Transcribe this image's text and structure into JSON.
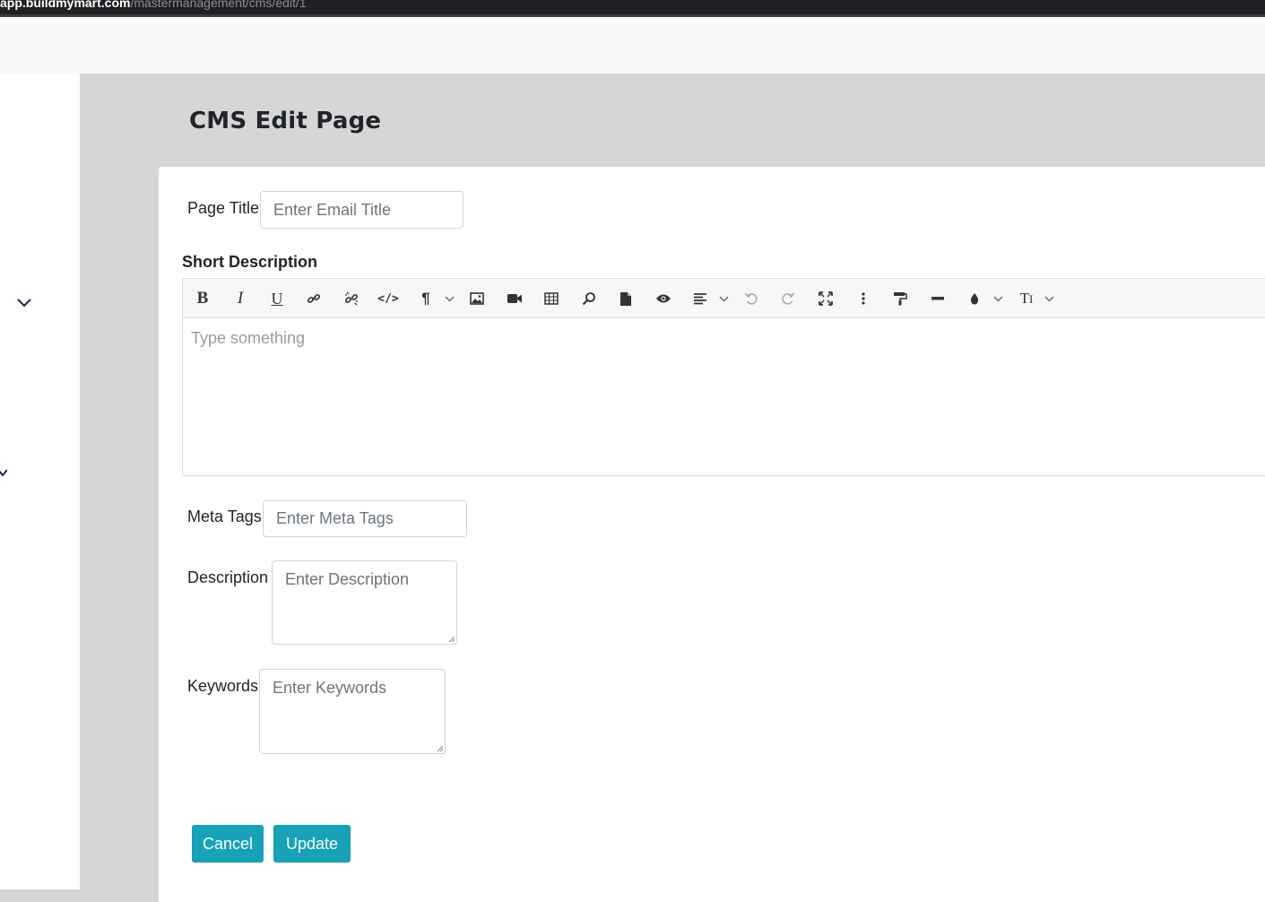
{
  "browser": {
    "url_host": "app.buildmymart.com",
    "url_path": "/mastermanagement/cms/edit/1"
  },
  "page": {
    "title": "CMS Edit Page"
  },
  "form": {
    "page_title": {
      "label": "Page Title",
      "placeholder": "Enter Email Title"
    },
    "short_description": {
      "label": "Short Description",
      "placeholder": "Type something",
      "toolbar": [
        "bold-icon",
        "italic-icon",
        "underline-icon",
        "link-icon",
        "unlink-icon",
        "code-view-icon",
        "paragraph-icon",
        "image-icon",
        "video-icon",
        "table-icon",
        "search-icon",
        "file-icon",
        "preview-icon",
        "align-icon",
        "undo-icon",
        "redo-icon",
        "fullscreen-icon",
        "more-icon",
        "format-painter-icon",
        "horizontal-rule-icon",
        "color-icon",
        "font-size-icon"
      ]
    },
    "meta_tags": {
      "label": "Meta Tags",
      "placeholder": "Enter Meta Tags"
    },
    "description": {
      "label": "Description",
      "placeholder": "Enter Description"
    },
    "keywords": {
      "label": "Keywords",
      "placeholder": "Enter Keywords"
    }
  },
  "actions": {
    "cancel_label": "Cancel",
    "update_label": "Update"
  },
  "colors": {
    "accent": "#17a2b8",
    "browser_bar": "#202124",
    "content_bg": "#d6d6d6"
  }
}
